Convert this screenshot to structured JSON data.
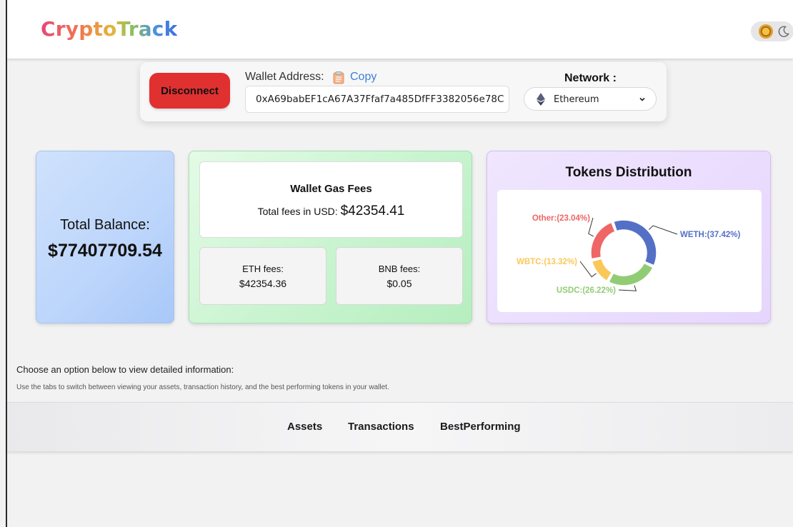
{
  "header": {
    "logo": "CryptoTrack",
    "theme_toggle_icons": [
      "sun-icon",
      "moon-icon"
    ]
  },
  "wallet": {
    "disconnect_label": "Disconnect",
    "address_label": "Wallet Address:",
    "copy_label": "Copy",
    "address": "0xA69babEF1cA67A37Ffaf7a485DfFF3382056e78C",
    "network_label": "Network :",
    "network_value": "Ethereum"
  },
  "balance": {
    "label": "Total Balance:",
    "value": "$77407709.54"
  },
  "gas": {
    "title": "Wallet Gas Fees",
    "total_prefix": "Total fees in USD:",
    "total_value": "$42354.41",
    "eth_label": "ETH fees:",
    "eth_value": "$42354.36",
    "bnb_label": "BNB fees:",
    "bnb_value": "$0.05"
  },
  "tokens": {
    "title": "Tokens Distribution"
  },
  "chart_data": {
    "type": "pie",
    "title": "Tokens Distribution",
    "categories": [
      "WETH",
      "USDC",
      "WBTC",
      "Other"
    ],
    "values": [
      37.42,
      26.22,
      13.32,
      23.04
    ],
    "labels": [
      "WETH:(37.42%)",
      "USDC:(26.22%)",
      "WBTC:(13.32%)",
      "Other:(23.04%)"
    ],
    "colors": [
      "#5470c6",
      "#91cc75",
      "#fac858",
      "#ee6666"
    ],
    "donut": true
  },
  "info": {
    "title": "Choose an option below to view detailed information:",
    "description": "Use the tabs to switch between viewing your assets, transaction history, and the best performing tokens in your wallet."
  },
  "tabs": [
    "Assets",
    "Transactions",
    "BestPerforming"
  ],
  "colors": {
    "disconnect": "#e03030",
    "copy_link": "#3d7fd6"
  }
}
